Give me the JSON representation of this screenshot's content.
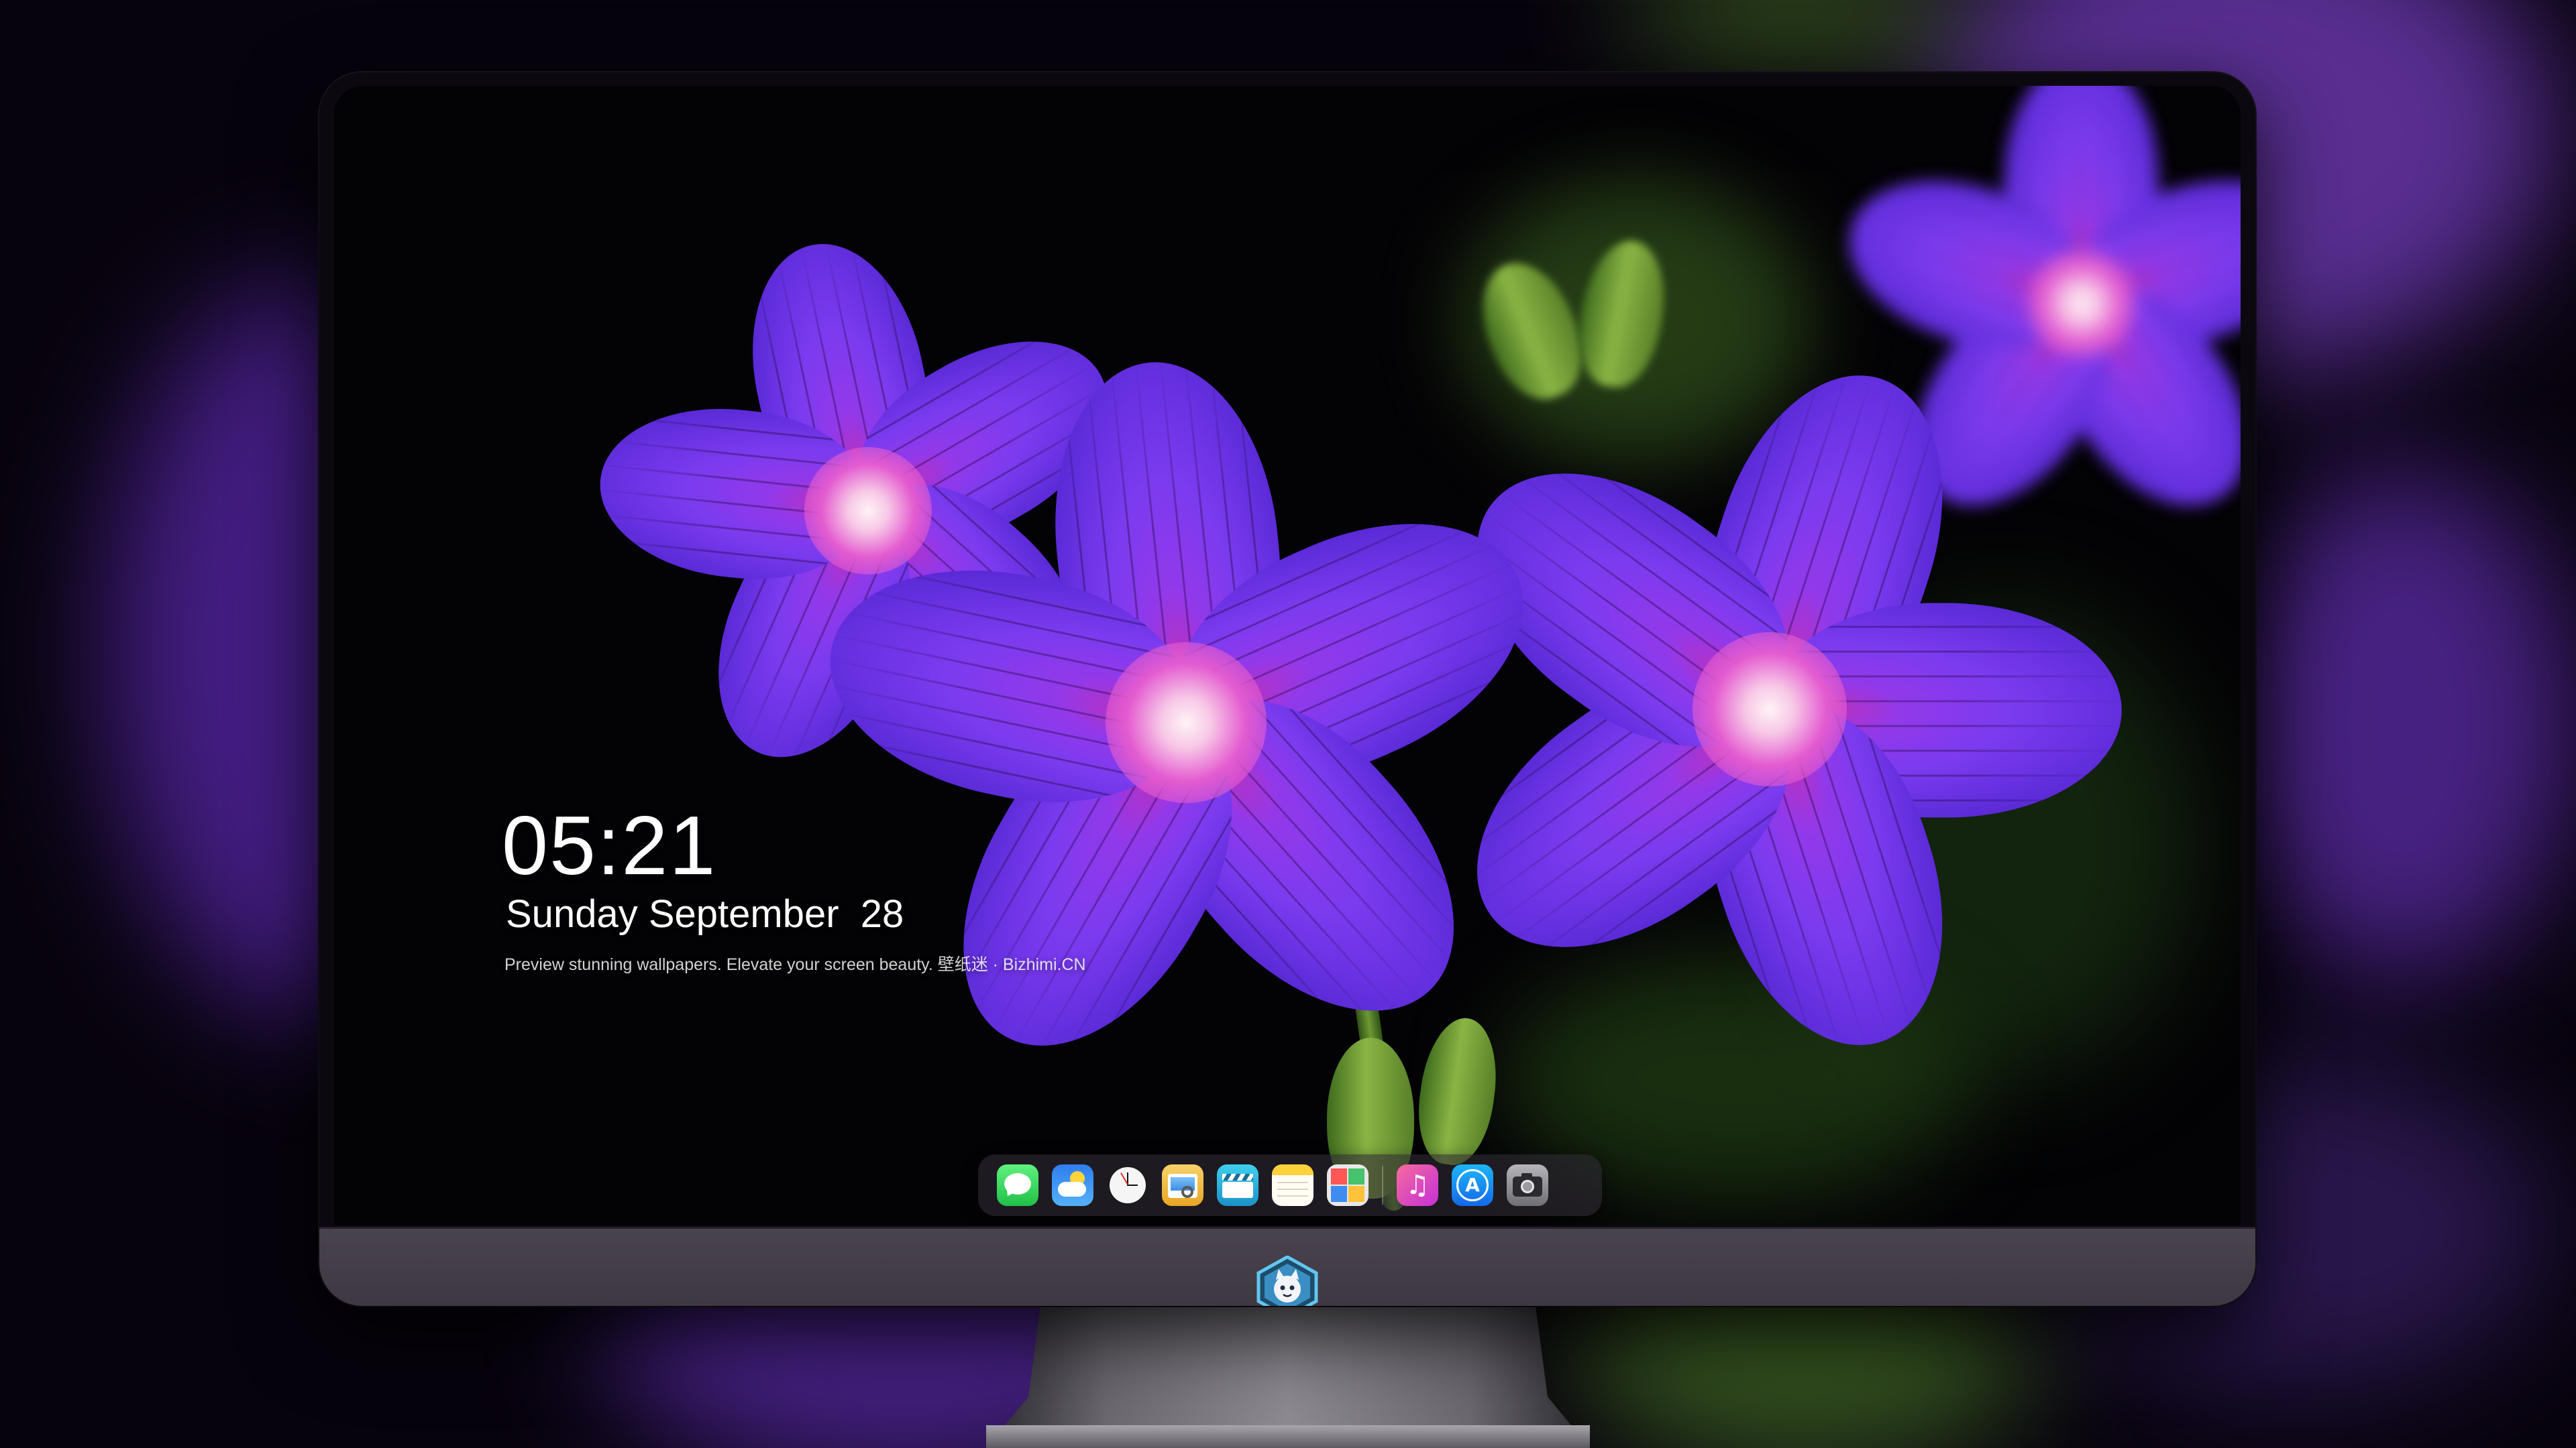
{
  "lockscreen": {
    "time": "05:21",
    "date": "Sunday September  28",
    "tagline": "Preview stunning wallpapers. Elevate your screen beauty. 壁纸迷 · Bizhimi.CN"
  },
  "dock": {
    "apps": [
      {
        "name": "messages-app-icon",
        "color": "#2fd158"
      },
      {
        "name": "weather-app-icon",
        "color": "#2e8ef0"
      },
      {
        "name": "clock-app-icon",
        "color": "#f2f2f2"
      },
      {
        "name": "preview-app-icon",
        "color": "#f2b92b"
      },
      {
        "name": "clips-app-icon",
        "color": "#28b9dd"
      },
      {
        "name": "notes-app-icon",
        "color": "#ffd23b"
      },
      {
        "name": "photo-booth-app-icon",
        "color": "#e23a3a"
      },
      {
        "name": "music-app-icon",
        "color": "#f5457a"
      },
      {
        "name": "app-store-icon",
        "color": "#1da1f7"
      },
      {
        "name": "camera-app-icon",
        "color": "#8e8e93"
      }
    ]
  },
  "wallpaper": {
    "subject": "purple-geranium-flowers",
    "colors": {
      "petal": "#7b3bef",
      "background": "#050208",
      "leaf": "#5b8a2a"
    }
  },
  "monitor": {
    "logo_icon": "cat-mascot-icon",
    "chin_color": "#443e48"
  }
}
